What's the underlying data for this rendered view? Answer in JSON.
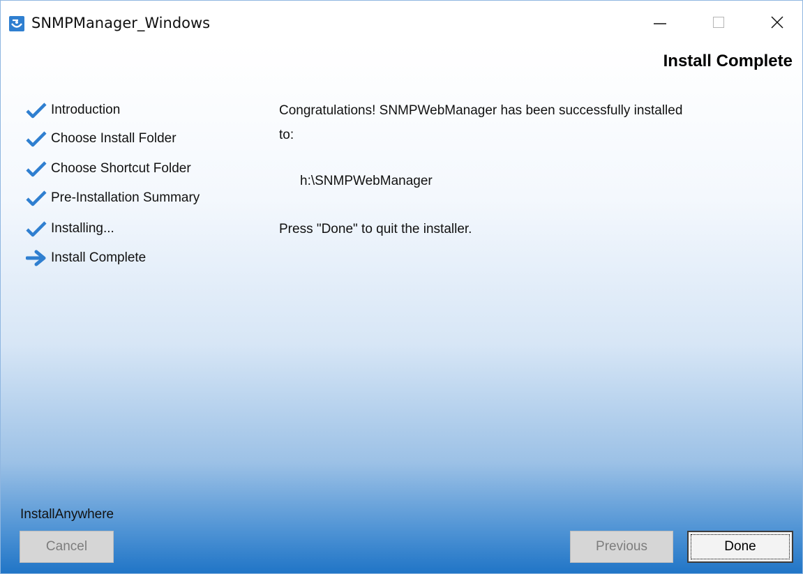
{
  "window": {
    "title": "SNMPManager_Windows"
  },
  "header": {
    "title": "Install Complete"
  },
  "steps": [
    {
      "label": "Introduction",
      "status": "done",
      "icon": "check-icon"
    },
    {
      "label": "Choose Install Folder",
      "status": "done",
      "icon": "check-icon"
    },
    {
      "label": "Choose Shortcut Folder",
      "status": "done",
      "icon": "check-icon"
    },
    {
      "label": "Pre-Installation Summary",
      "status": "done",
      "icon": "check-icon"
    },
    {
      "label": "Installing...",
      "status": "done",
      "icon": "check-icon"
    },
    {
      "label": "Install Complete",
      "status": "current",
      "icon": "arrow-right-icon"
    }
  ],
  "main": {
    "message_line1": "Congratulations! SNMPWebManager has been successfully installed",
    "message_line2": "to:",
    "install_path": "h:\\SNMPWebManager",
    "instruction": "Press \"Done\" to quit the installer."
  },
  "footer": {
    "brand": "InstallAnywhere",
    "cancel_label": "Cancel",
    "previous_label": "Previous",
    "done_label": "Done"
  },
  "colors": {
    "accent": "#2f7fd0",
    "gradient_bottom": "#1f74c6",
    "disabled_button": "#d6d6d6"
  }
}
